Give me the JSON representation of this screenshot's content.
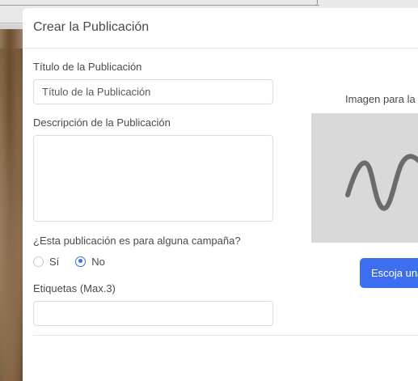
{
  "modal": {
    "title": "Crear la Publicación"
  },
  "form": {
    "title_label": "Título de la Publicación",
    "title_placeholder": "Título de la Publicación",
    "description_label": "Descripción de la Publicación",
    "campaign_question": "¿Esta publicación es para alguna campaña?",
    "campaign_options": [
      {
        "label": "Sí",
        "checked": false
      },
      {
        "label": "No",
        "checked": true
      }
    ],
    "tags_label": "Etiquetas (Max.3)"
  },
  "image_panel": {
    "label": "Imagen para la P",
    "button_label": "Escoja una"
  },
  "colors": {
    "accent": "#3d6ef0",
    "placeholder_bg": "#d9d9d9",
    "placeholder_icon": "#6b6b6b"
  },
  "icons": {
    "image_placeholder": "wave-icon"
  }
}
